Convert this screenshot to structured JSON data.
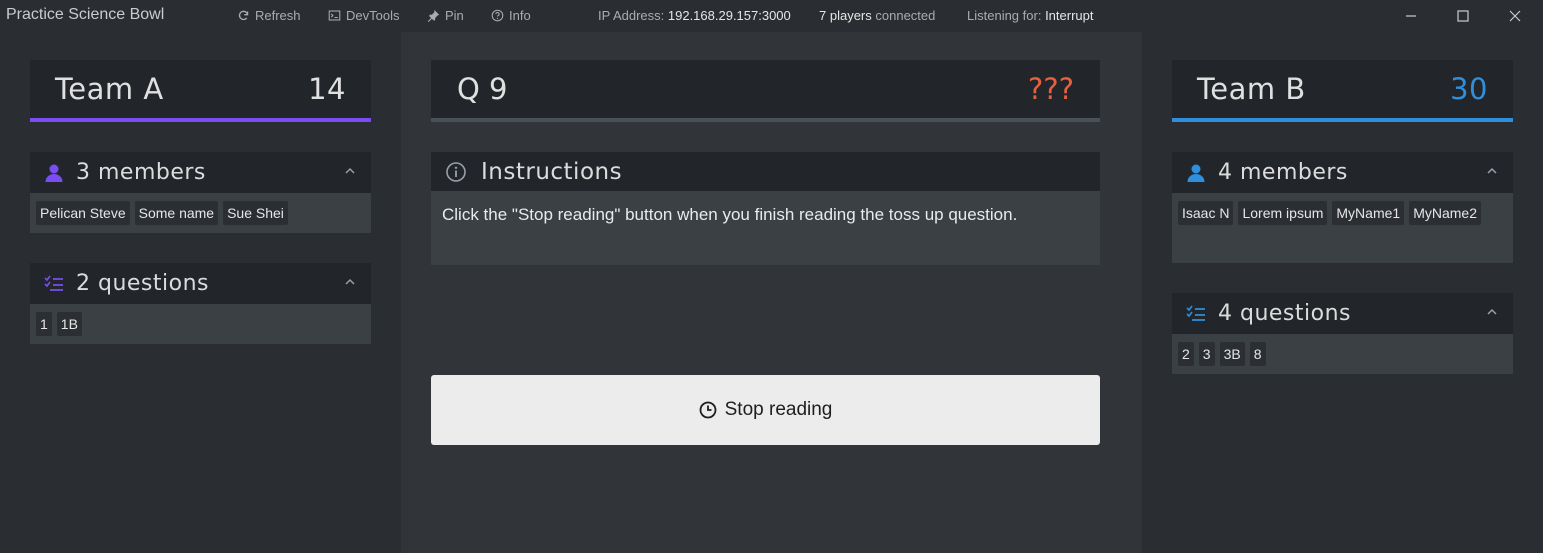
{
  "app": {
    "title": "Practice Science Bowl"
  },
  "toolbar": {
    "refresh": "Refresh",
    "devtools": "DevTools",
    "pin": "Pin",
    "info": "Info",
    "ip_label": "IP Address:",
    "ip_value": "192.168.29.157:3000",
    "players_count": "7 players",
    "players_suffix": "connected",
    "listening_label": "Listening for:",
    "listening_value": "Interrupt"
  },
  "team_a": {
    "name": "Team A",
    "score": "14",
    "accent": "#7a4df0",
    "members_title": "3 members",
    "members": [
      "Pelican Steve",
      "Some name",
      "Sue Shei"
    ],
    "questions_title": "2 questions",
    "questions": [
      "1",
      "1B"
    ]
  },
  "team_b": {
    "name": "Team B",
    "score": "30",
    "accent": "#2f8fdc",
    "members_title": "4 members",
    "members": [
      "Isaac N",
      "Lorem ipsum",
      "MyName1",
      "MyName2"
    ],
    "questions_title": "4 questions",
    "questions": [
      "2",
      "3",
      "3B",
      "8"
    ]
  },
  "question": {
    "label": "Q 9",
    "value": "???",
    "value_color": "#e5603f"
  },
  "instructions": {
    "title": "Instructions",
    "text": "Click the \"Stop reading\" button when you finish reading the toss up question."
  },
  "stop_button": {
    "label": "Stop reading"
  },
  "icons": {
    "refresh": "refresh-icon",
    "devtools": "terminal-icon",
    "pin": "pin-icon",
    "info": "help-circle-icon",
    "members": "user-icon",
    "questions": "checklist-icon",
    "instructions": "info-icon",
    "stop": "clock-icon"
  }
}
